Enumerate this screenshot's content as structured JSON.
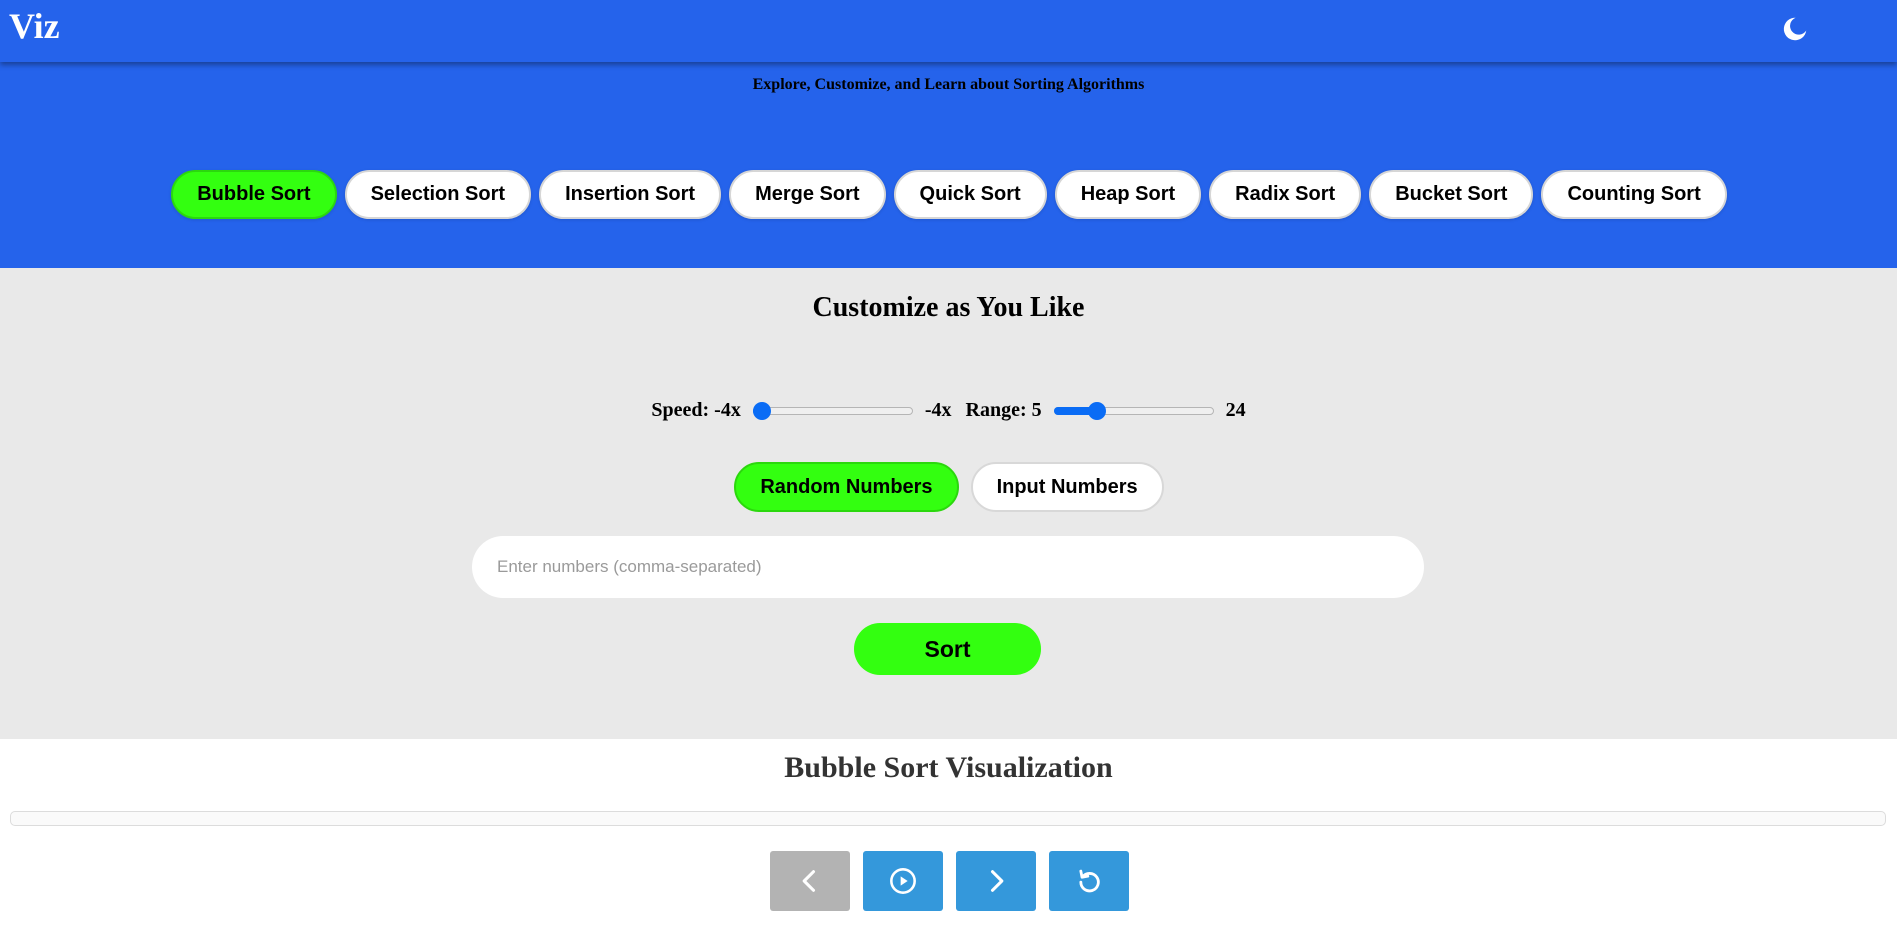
{
  "header": {
    "logo": "Viz",
    "theme_toggle_icon": "moon-icon"
  },
  "hero": {
    "tagline": "Explore, Customize, and Learn about Sorting Algorithms",
    "algorithms": [
      {
        "label": "Bubble Sort",
        "active": true
      },
      {
        "label": "Selection Sort",
        "active": false
      },
      {
        "label": "Insertion Sort",
        "active": false
      },
      {
        "label": "Merge Sort",
        "active": false
      },
      {
        "label": "Quick Sort",
        "active": false
      },
      {
        "label": "Heap Sort",
        "active": false
      },
      {
        "label": "Radix Sort",
        "active": false
      },
      {
        "label": "Bucket Sort",
        "active": false
      },
      {
        "label": "Counting Sort",
        "active": false
      }
    ]
  },
  "customize": {
    "title": "Customize as You Like",
    "speed": {
      "label": "Speed: -4x",
      "value_text": "-4x",
      "level": 0.0
    },
    "range": {
      "label": "Range: 5",
      "value_text": "24",
      "level": 0.24
    },
    "modes": [
      {
        "label": "Random Numbers",
        "active": true
      },
      {
        "label": "Input Numbers",
        "active": false
      }
    ],
    "input": {
      "placeholder": "Enter numbers (comma-separated)",
      "value": ""
    },
    "sort_button": "Sort"
  },
  "visualization": {
    "title": "Bubble Sort Visualization",
    "controls": [
      {
        "icon": "chevron-left-icon",
        "enabled": false
      },
      {
        "icon": "play-circle-icon",
        "enabled": true
      },
      {
        "icon": "chevron-right-icon",
        "enabled": true
      },
      {
        "icon": "reset-icon",
        "enabled": true
      }
    ]
  },
  "colors": {
    "brand_blue": "#2563eb",
    "active_green": "#33ff10",
    "control_blue": "#3498db",
    "disabled_gray": "#b3b3b3",
    "slider_blue": "#0a6cf5"
  }
}
